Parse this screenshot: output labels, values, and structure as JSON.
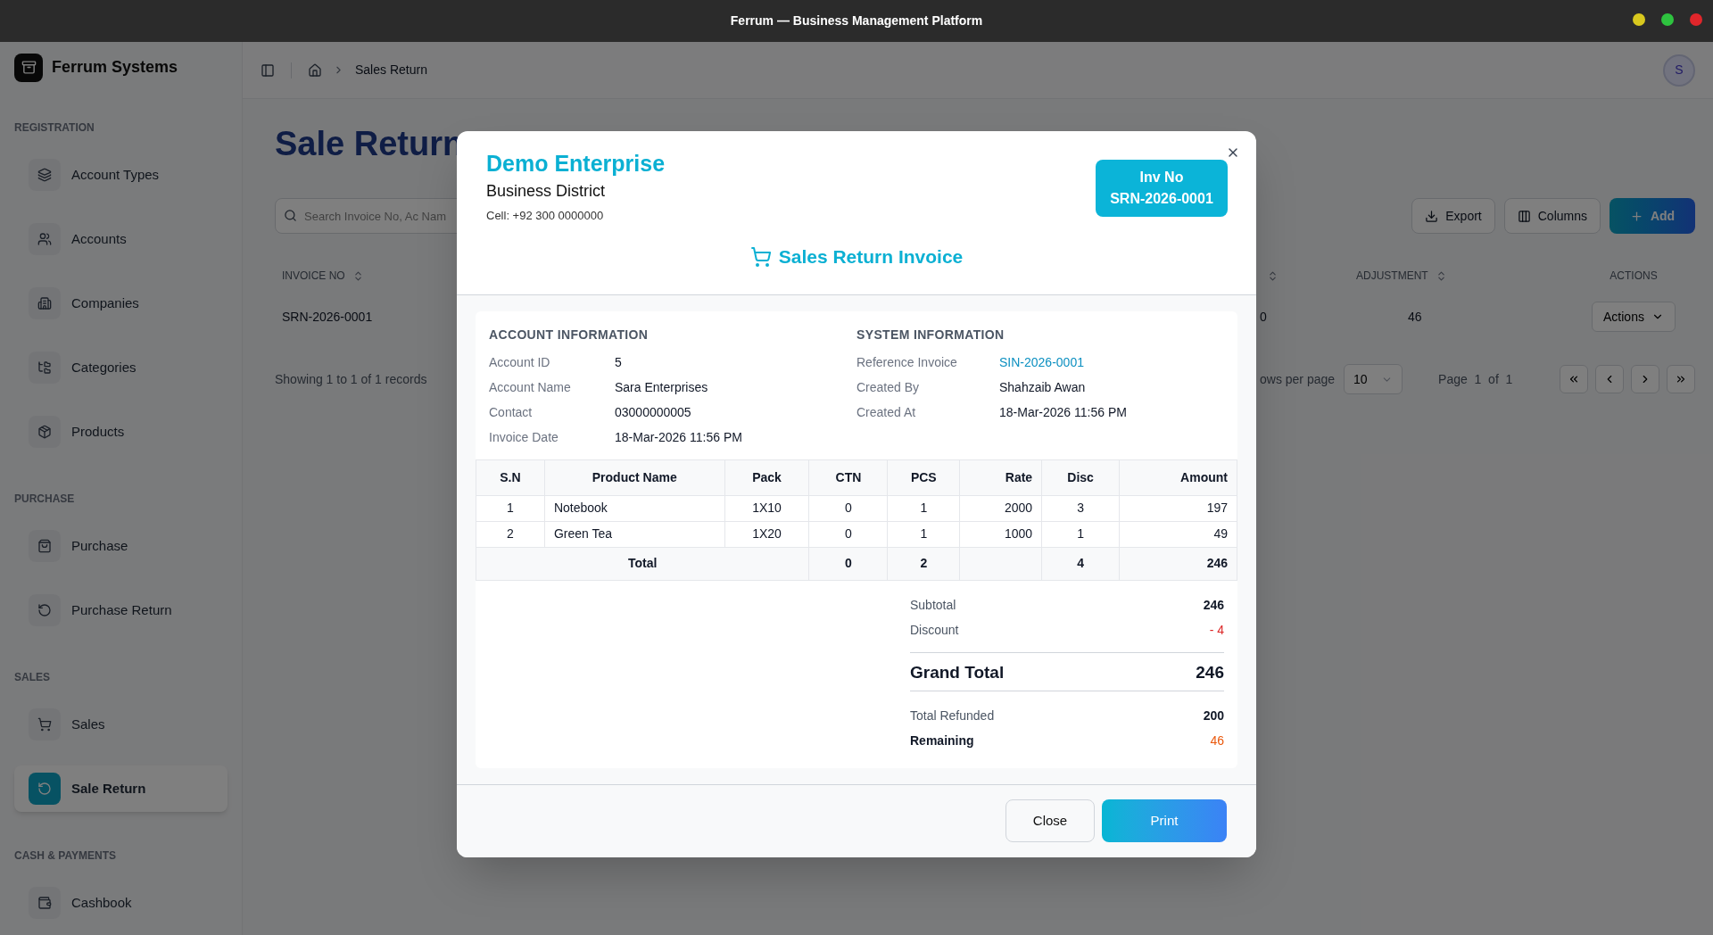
{
  "window": {
    "title": "Ferrum — Business Management Platform",
    "controls": [
      {
        "color": "#d8c81e"
      },
      {
        "color": "#2ec33f"
      },
      {
        "color": "#e0262b"
      }
    ]
  },
  "sidebar": {
    "brand": "Ferrum Systems",
    "sections": [
      {
        "heading": "REGISTRATION",
        "items": [
          {
            "label": "Account Types",
            "selected": false
          },
          {
            "label": "Accounts",
            "selected": false
          },
          {
            "label": "Companies",
            "selected": false
          },
          {
            "label": "Categories",
            "selected": false
          },
          {
            "label": "Products",
            "selected": false
          }
        ]
      },
      {
        "heading": "PURCHASE",
        "items": [
          {
            "label": "Purchase",
            "selected": false
          },
          {
            "label": "Purchase Return",
            "selected": false
          }
        ]
      },
      {
        "heading": "SALES",
        "items": [
          {
            "label": "Sales",
            "selected": false
          },
          {
            "label": "Sale Return",
            "selected": true
          }
        ]
      },
      {
        "heading": "CASH & PAYMENTS",
        "items": [
          {
            "label": "Cashbook",
            "selected": false
          }
        ]
      }
    ]
  },
  "header": {
    "breadcrumb": "Sales Return",
    "avatar": "S"
  },
  "page": {
    "title": "Sale Return",
    "search": {
      "placeholder": "Search Invoice No, Ac Nam"
    },
    "buttons": [
      {
        "kind": "export",
        "label": "Export"
      },
      {
        "kind": "columns",
        "label": "Columns"
      },
      {
        "kind": "add",
        "label": "Add"
      }
    ]
  },
  "table": {
    "columns": [
      {
        "label": "INVOICE NO",
        "sortable": true
      },
      {
        "sortable": true
      },
      {
        "label": "ADJUSTMENT",
        "sortable": true
      },
      {
        "label": "ACTIONS",
        "sortable": false
      }
    ],
    "rows": [
      {
        "cells": [
          "SRN-2026-0001",
          "0",
          "46"
        ],
        "action": "Actions"
      }
    ]
  },
  "pagination": {
    "summary": "Showing 1 to 1 of 1 records",
    "rows_label": "ows per page",
    "rows_per_page": "10",
    "page_text": "Page  1  of  1"
  },
  "modal": {
    "company": "Demo Enterprise",
    "address": "Business District",
    "cell": "Cell: +92 300 0000000",
    "badge": {
      "label": "Inv No",
      "value": "SRN-2026-0001"
    },
    "title": "Sales Return Invoice",
    "account_info": {
      "heading": "ACCOUNT INFORMATION",
      "fields": [
        {
          "label": "Account ID",
          "value": "5",
          "kind": "text"
        },
        {
          "label": "Account Name",
          "value": "Sara Enterprises",
          "kind": "text"
        },
        {
          "label": "Contact",
          "value": "03000000005",
          "kind": "text"
        },
        {
          "label": "Invoice Date",
          "value": "18-Mar-2026 11:56 PM",
          "kind": "text"
        }
      ]
    },
    "system_info": {
      "heading": "SYSTEM INFORMATION",
      "fields": [
        {
          "label": "Reference Invoice",
          "value": "SIN-2026-0001",
          "kind": "link"
        },
        {
          "label": "Created By",
          "value": "Shahzaib Awan",
          "kind": "text"
        },
        {
          "label": "Created At",
          "value": "18-Mar-2026 11:56 PM",
          "kind": "text"
        }
      ]
    },
    "items": {
      "columns": [
        "S.N",
        "Product Name",
        "Pack",
        "CTN",
        "PCS",
        "Rate",
        "Disc",
        "Amount"
      ],
      "rows": [
        [
          "1",
          "Notebook",
          "1X10",
          "0",
          "1",
          "2000",
          "3",
          "197"
        ],
        [
          "2",
          "Green Tea",
          "1X20",
          "0",
          "1",
          "1000",
          "1",
          "49"
        ]
      ],
      "total": {
        "label": "Total",
        "ctn": "0",
        "pcs": "2",
        "disc": "4",
        "amount": "246"
      }
    },
    "summary": [
      {
        "label": "Subtotal",
        "value": "246",
        "kind": "normal"
      },
      {
        "label": "Discount",
        "value": "- 4",
        "kind": "negative"
      },
      {
        "label": "Grand Total",
        "value": "246",
        "kind": "grand"
      },
      {
        "label": "Total Refunded",
        "value": "200",
        "kind": "normal"
      },
      {
        "label": "Remaining",
        "value": "46",
        "kind": "remaining"
      }
    ],
    "buttons": [
      {
        "kind": "secondary",
        "label": "Close"
      },
      {
        "kind": "primary",
        "label": "Print"
      }
    ]
  }
}
